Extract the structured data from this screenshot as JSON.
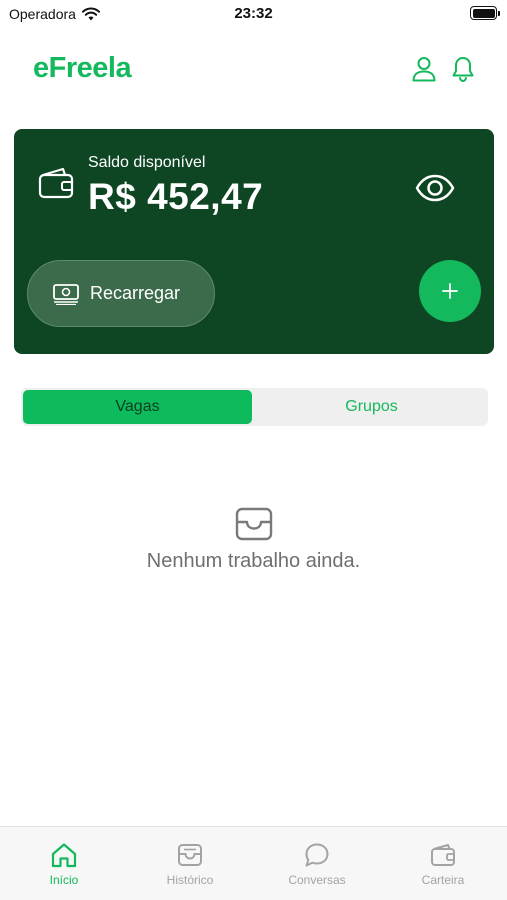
{
  "status_bar": {
    "carrier": "Operadora",
    "time": "23:32"
  },
  "header": {
    "logo": "eFreela",
    "profile_icon": "user-icon",
    "notifications_icon": "bell-icon"
  },
  "balance_card": {
    "label": "Saldo disponível",
    "amount": "R$ 452,47",
    "recharge_label": "Recarregar",
    "background": "#0e4623"
  },
  "segment": {
    "tabs": [
      "Vagas",
      "Grupos"
    ],
    "selected": "Vagas"
  },
  "empty_state": {
    "message": "Nenhum trabalho ainda."
  },
  "tabbar": {
    "items": [
      {
        "label": "Início",
        "icon": "home-icon",
        "active": true
      },
      {
        "label": "Histórico",
        "icon": "inbox-icon",
        "active": false
      },
      {
        "label": "Conversas",
        "icon": "chat-icon",
        "active": false
      },
      {
        "label": "Carteira",
        "icon": "wallet-icon",
        "active": false
      }
    ]
  },
  "colors": {
    "accent": "#13b95c",
    "card": "#0e4623",
    "inactive": "#a3a3a3"
  }
}
